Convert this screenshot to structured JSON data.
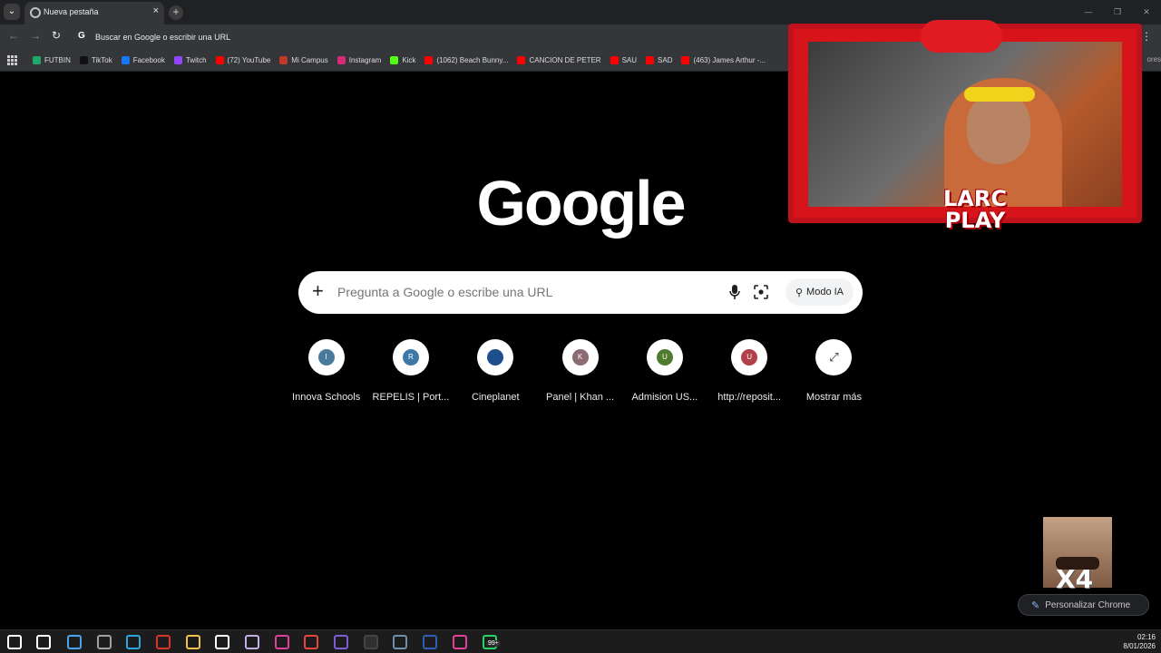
{
  "browser": {
    "tab_title": "Nueva pestaña",
    "tab_close": "×",
    "new_tab": "+",
    "omnibox_g": "G",
    "omnibox_text": "Buscar en Google o escribir una URL",
    "bookmarks": [
      {
        "label": "FUTBIN",
        "color": "#1ea86a"
      },
      {
        "label": "TikTok",
        "color": "#111111"
      },
      {
        "label": "Facebook",
        "color": "#1877f2"
      },
      {
        "label": "Twitch",
        "color": "#9146ff"
      },
      {
        "label": "(72) YouTube",
        "color": "#ff0000"
      },
      {
        "label": "Mi Campus",
        "color": "#c0392b"
      },
      {
        "label": "Instagram",
        "color": "#d62976"
      },
      {
        "label": "Kick",
        "color": "#53fc18"
      },
      {
        "label": "(1062) Beach Bunny...",
        "color": "#ff0000"
      },
      {
        "label": "CANCION DE PETER",
        "color": "#ff0000"
      },
      {
        "label": "SAU",
        "color": "#ff0000"
      },
      {
        "label": "SAD",
        "color": "#ff0000"
      },
      {
        "label": "(463) James Arthur -...",
        "color": "#ff0000"
      }
    ],
    "bookmarks_overflow": "ores"
  },
  "page": {
    "logo": "Google",
    "search": {
      "placeholder": "Pregunta a Google o escribe una URL",
      "plus": "+",
      "modo_ia": "Modo IA"
    },
    "shortcuts": [
      {
        "label": "Innova Schools",
        "letter": "I",
        "color": "#4a7a9b"
      },
      {
        "label": "REPELIS | Port...",
        "letter": "R",
        "color": "#3e78a8"
      },
      {
        "label": "Cineplanet",
        "letter": "",
        "color": "#1f4e8c"
      },
      {
        "label": "Panel | Khan ...",
        "letter": "K",
        "color": "#8c6b73"
      },
      {
        "label": "Admision US...",
        "letter": "U",
        "color": "#4e7a2e"
      },
      {
        "label": "http://reposit...",
        "letter": "U",
        "color": "#b0414a"
      },
      {
        "label": "Mostrar más",
        "letter": "⤢",
        "color": "#ffffff"
      }
    ],
    "customize": "Personalizar Chrome"
  },
  "overlay": {
    "stream_logo_line1": "LARC",
    "stream_logo_line2": "PLAY",
    "meme_text": "X4"
  },
  "taskbar": {
    "time": "02:16",
    "date": "8/01/2026",
    "badge": "99+",
    "icons": [
      {
        "name": "windows-start-icon",
        "color": "#ffffff"
      },
      {
        "name": "search-icon",
        "color": "#ffffff"
      },
      {
        "name": "store-icon",
        "color": "#4aa3f0"
      },
      {
        "name": "app-icon",
        "color": "#9aa0a6"
      },
      {
        "name": "edge-icon",
        "color": "#2aa5e0"
      },
      {
        "name": "red-app-icon",
        "color": "#d9342b"
      },
      {
        "name": "file-explorer-icon",
        "color": "#f2c14e"
      },
      {
        "name": "logitech-icon",
        "color": "#ffffff"
      },
      {
        "name": "paint-icon",
        "color": "#c4b0e0"
      },
      {
        "name": "pink-app-icon",
        "color": "#e0409a"
      },
      {
        "name": "chrome-icon",
        "color": "#e8453c"
      },
      {
        "name": "discord-icon",
        "color": "#7b5cd6"
      },
      {
        "name": "obs-icon",
        "color": "#444444"
      },
      {
        "name": "calculator-icon",
        "color": "#6e8cab"
      },
      {
        "name": "word-icon",
        "color": "#2b5fb8"
      },
      {
        "name": "pink-app-2-icon",
        "color": "#e0409a"
      },
      {
        "name": "whatsapp-icon",
        "color": "#25d366"
      }
    ]
  }
}
